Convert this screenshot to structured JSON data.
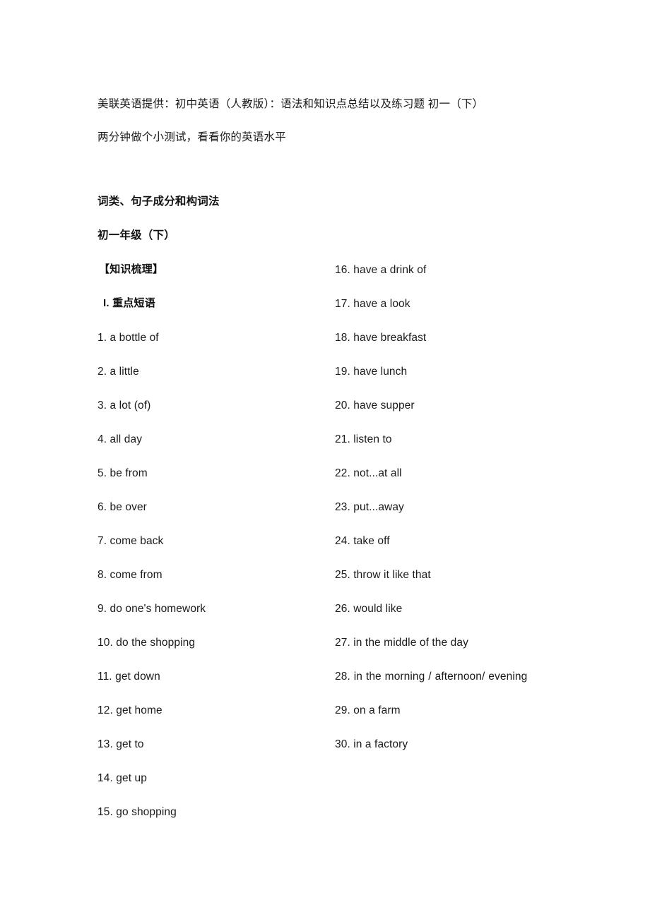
{
  "document": {
    "header": {
      "lines": [
        "美联英语提供：初中英语（人教版）：语法和知识点总结以及练习题 初一（下）",
        "两分钟做个小测试，看看你的英语水平"
      ]
    },
    "section_title": "词类、句子成分和构词法",
    "grade_title": "初一年级（下）",
    "knowledge_label": "【知识梳理】",
    "subsection_label": "I. 重点短语",
    "phrases_left": [
      "1. a bottle of",
      "2. a little",
      "3. a lot (of)",
      "4. all day",
      "5. be from",
      "6. be over",
      "7. come back",
      "8. come from",
      "9. do one's homework",
      "10. do the shopping",
      "11. get down",
      "12. get home",
      "13. get to",
      "14. get up",
      "15. go shopping"
    ],
    "phrases_right": [
      "16. have a drink of",
      "17. have a look",
      "18. have breakfast",
      "19. have lunch",
      "20. have supper",
      "21. listen to",
      "22. not...at all",
      "23. put...away",
      "24. take off",
      "25. throw it like that",
      "26. would like",
      "27. in the middle of the day"
    ],
    "phrase_28": "28. in the morning / afternoon/ evening",
    "phrases_right_tail": [
      "29. on a farm",
      "30. in a factory"
    ],
    "colors": {
      "page_background": "#ffffff",
      "body_text": "#1a1a1a",
      "heading_text": "#111111"
    }
  }
}
